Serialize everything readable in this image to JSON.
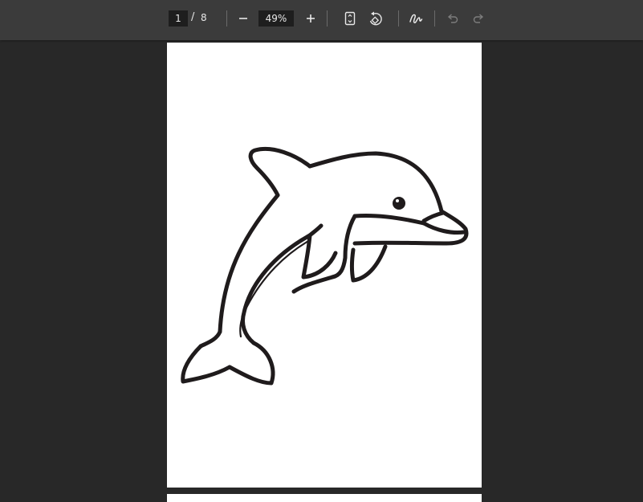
{
  "toolbar": {
    "current_page": "1",
    "page_separator": "/",
    "total_pages": "8",
    "zoom_level": "49%"
  },
  "icons": {
    "zoom_out": "minus-icon",
    "zoom_in": "plus-icon",
    "fit_page": "fit-page-icon",
    "rotate": "rotate-icon",
    "annotate": "draw-icon",
    "undo": "undo-icon",
    "redo": "redo-icon"
  },
  "document": {
    "page_1_content": "dolphin-outline-drawing"
  }
}
